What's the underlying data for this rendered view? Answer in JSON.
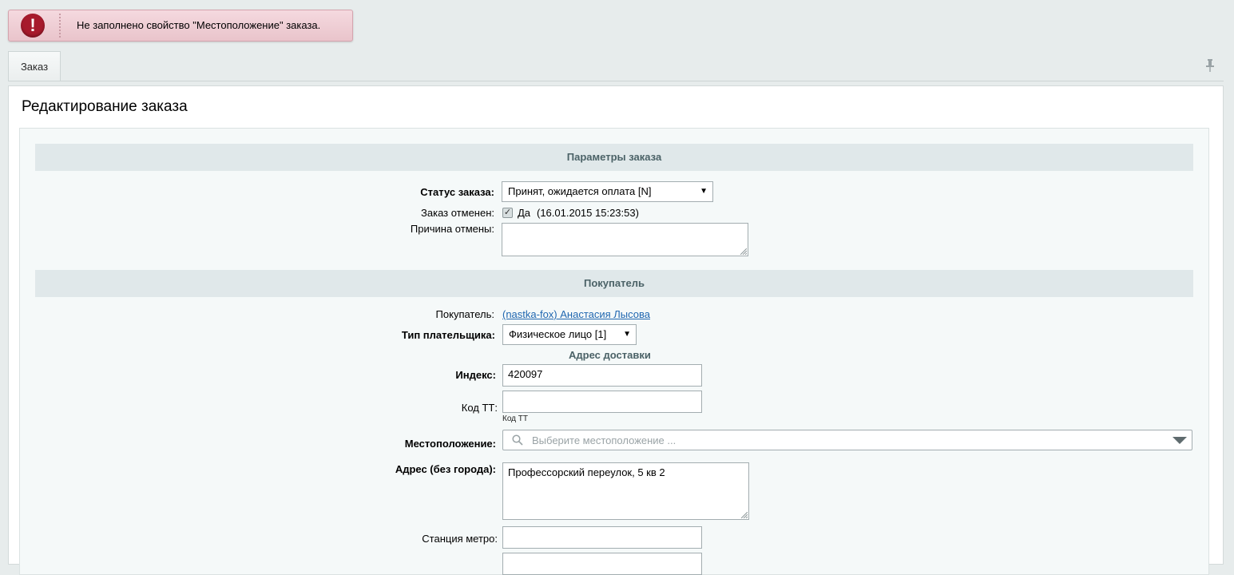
{
  "error": {
    "message": "Не заполнено свойство \"Местоположение\" заказа.",
    "icon": "exclamation-icon"
  },
  "tabs": [
    {
      "label": "Заказ"
    }
  ],
  "page": {
    "title": "Редактирование заказа"
  },
  "sections": {
    "order_params": "Параметры заказа",
    "buyer": "Покупатель"
  },
  "order": {
    "status_label": "Статус заказа:",
    "status_value": "Принят, ожидается оплата [N]",
    "canceled_label": "Заказ отменен:",
    "canceled_value": "Да",
    "canceled_date": "(16.01.2015 15:23:53)",
    "cancel_reason_label": "Причина отмены:",
    "cancel_reason_value": ""
  },
  "buyer": {
    "buyer_label": "Покупатель:",
    "buyer_link": "(nastka-fox) Анастасия Лысова",
    "payer_type_label": "Тип плательщика:",
    "payer_type_value": "Физическое лицо [1]",
    "delivery_title": "Адрес доставки",
    "index_label": "Индекс:",
    "index_value": "420097",
    "tt_code_label": "Код ТТ:",
    "tt_code_value": "",
    "tt_code_hint": "Код ТТ",
    "location_label": "Местоположение:",
    "location_placeholder": "Выберите местоположение ...",
    "address_label": "Адрес (без города):",
    "address_value": "Профессорский переулок, 5 кв 2",
    "metro_label": "Станция метро:",
    "metro_value": ""
  },
  "colors": {
    "error_bg": "#f5d9df",
    "error_icon": "#a71a2c",
    "section_bg": "#e0e8ea",
    "link": "#2067b0"
  }
}
